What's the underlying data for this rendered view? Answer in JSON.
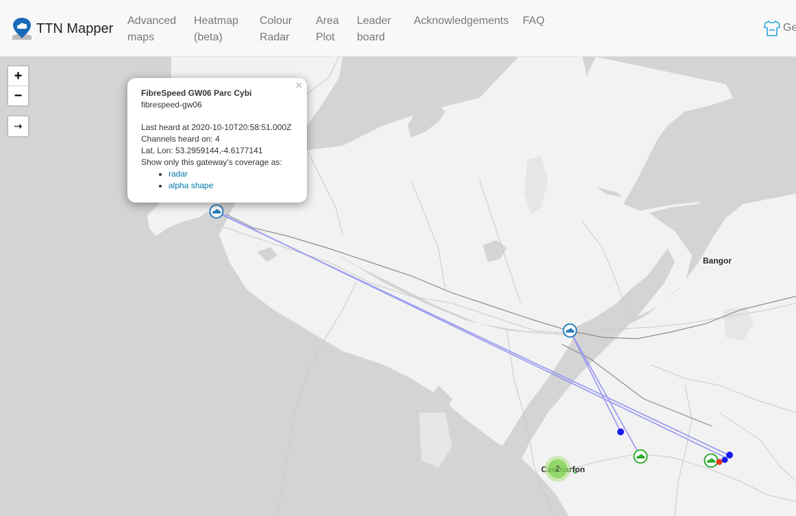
{
  "navbar": {
    "brand": "TTN Mapper",
    "items": [
      {
        "label": "Advanced\nmaps",
        "l1": "Advanced",
        "l2": "maps"
      },
      {
        "l1": "Heatmap",
        "l2": "(beta)"
      },
      {
        "l1": "Colour",
        "l2": "Radar"
      },
      {
        "l1": "Area",
        "l2": "Plot"
      },
      {
        "l1": "Leader",
        "l2": "board"
      },
      {
        "l1": "Acknowledgements"
      },
      {
        "l1": "FAQ"
      }
    ],
    "right_label": "Ge",
    "right_icon": "shirt-icon"
  },
  "map": {
    "zoom_in": "+",
    "zoom_out": "−",
    "extra_control": "⇢",
    "labels": {
      "bangor": "Bangor",
      "caernarfon": "Caernarfon"
    },
    "cluster_count": "2",
    "colors": {
      "water": "#d4d4d4",
      "land": "#f2f2f2",
      "link_line": "#8f8ff2",
      "gateway_icon": "#2a7fba",
      "gateway_green": "#2eaa2e",
      "point_blue": "#1a1aee",
      "point_red": "#e23b1e"
    }
  },
  "popup": {
    "title": "FibreSpeed GW06 Parc Cybi",
    "id": "fibrespeed-gw06",
    "last_heard": "Last heard at 2020-10-10T20:58:51.000Z",
    "channels": "Channels heard on: 4",
    "latlon": "Lat, Lon: 53.2959144,-4.6177141",
    "show_only": "Show only this gateway's coverage as:",
    "links": [
      "radar",
      "alpha shape"
    ],
    "close": "×"
  }
}
